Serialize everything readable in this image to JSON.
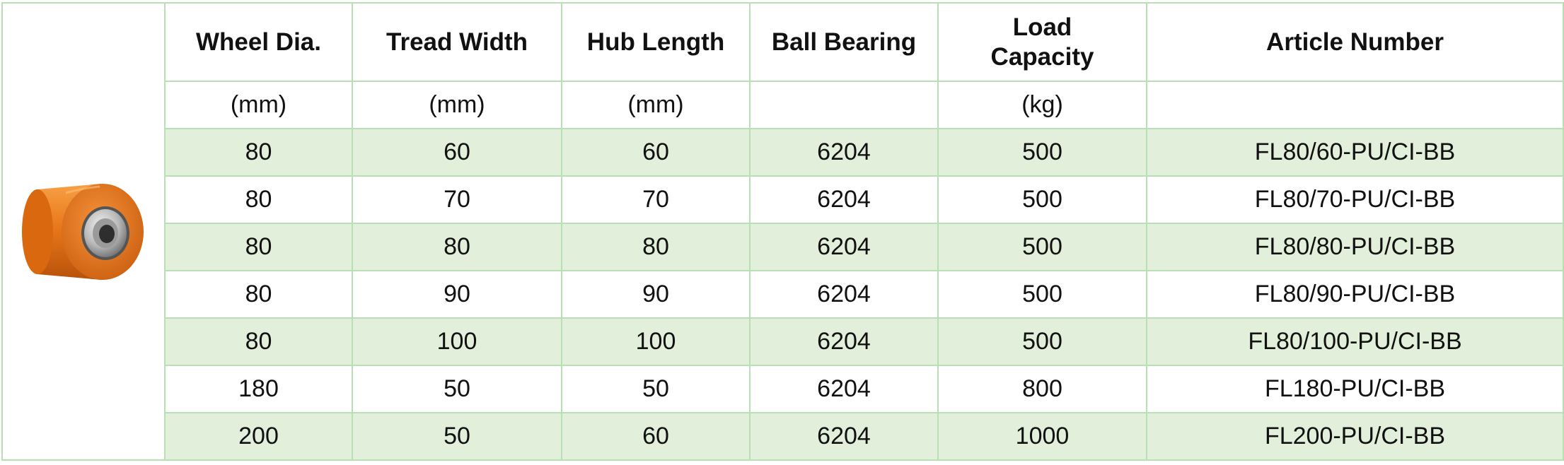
{
  "product_image": {
    "icon": "polyurethane-wheel-icon"
  },
  "columns": [
    {
      "header": "Wheel Dia.",
      "unit": "(mm)"
    },
    {
      "header": "Tread Width",
      "unit": "(mm)"
    },
    {
      "header": "Hub Length",
      "unit": "(mm)"
    },
    {
      "header": "Ball Bearing",
      "unit": ""
    },
    {
      "header": "Load\nCapacity",
      "unit": "(kg)"
    },
    {
      "header": "Article Number",
      "unit": ""
    }
  ],
  "rows": [
    [
      "80",
      "60",
      "60",
      "6204",
      "500",
      "FL80/60-PU/CI-BB"
    ],
    [
      "80",
      "70",
      "70",
      "6204",
      "500",
      "FL80/70-PU/CI-BB"
    ],
    [
      "80",
      "80",
      "80",
      "6204",
      "500",
      "FL80/80-PU/CI-BB"
    ],
    [
      "80",
      "90",
      "90",
      "6204",
      "500",
      "FL80/90-PU/CI-BB"
    ],
    [
      "80",
      "100",
      "100",
      "6204",
      "500",
      "FL80/100-PU/CI-BB"
    ],
    [
      "180",
      "50",
      "50",
      "6204",
      "800",
      "FL180-PU/CI-BB"
    ],
    [
      "200",
      "50",
      "60",
      "6204",
      "1000",
      "FL200-PU/CI-BB"
    ]
  ],
  "colors": {
    "border": "#b9e0b5",
    "row_shade": "#e2efda",
    "wheel_orange": "#e8781a"
  }
}
